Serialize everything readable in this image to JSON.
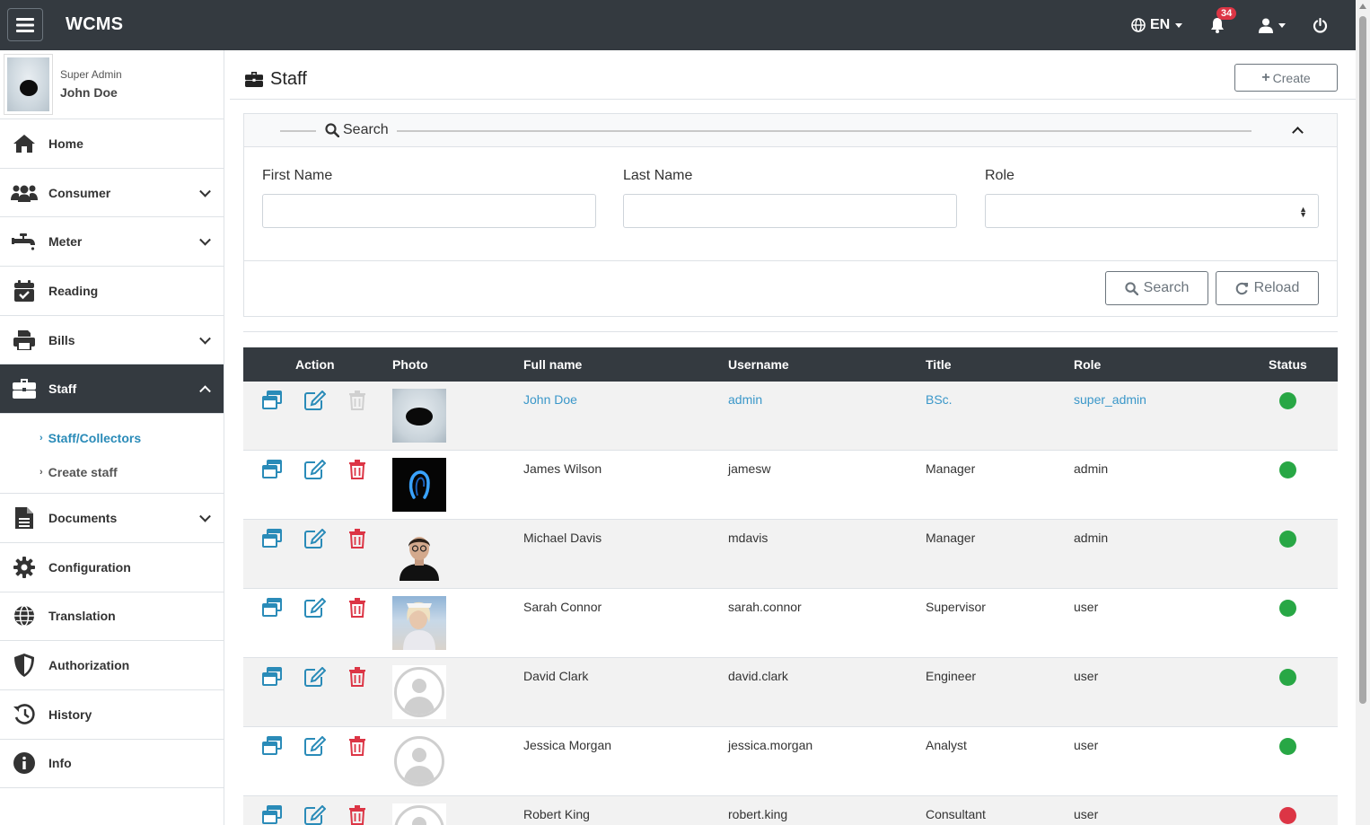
{
  "app": {
    "brand": "WCMS"
  },
  "topbar": {
    "language": "EN",
    "notification_count": "34"
  },
  "user": {
    "role": "Super Admin",
    "name": "John Doe"
  },
  "sidebar": {
    "items": [
      {
        "label": "Home",
        "icon": "home-icon"
      },
      {
        "label": "Consumer",
        "icon": "users-icon"
      },
      {
        "label": "Meter",
        "icon": "faucet-icon"
      },
      {
        "label": "Reading",
        "icon": "calendar-check-icon"
      },
      {
        "label": "Bills",
        "icon": "printer-icon"
      },
      {
        "label": "Staff",
        "icon": "briefcase-icon"
      },
      {
        "label": "Documents",
        "icon": "document-icon"
      },
      {
        "label": "Configuration",
        "icon": "gear-icon"
      },
      {
        "label": "Translation",
        "icon": "globe-icon"
      },
      {
        "label": "Authorization",
        "icon": "shield-icon"
      },
      {
        "label": "History",
        "icon": "history-icon"
      },
      {
        "label": "Info",
        "icon": "info-icon"
      }
    ],
    "staff_submenu": [
      "Staff/Collectors",
      "Create staff"
    ]
  },
  "page": {
    "title": "Staff",
    "create_label": "Create"
  },
  "search": {
    "title": "Search",
    "first_name_label": "First Name",
    "last_name_label": "Last Name",
    "role_label": "Role",
    "first_name_value": "",
    "last_name_value": "",
    "role_value": "",
    "search_button": "Search",
    "reload_button": "Reload"
  },
  "table": {
    "headers": [
      "Action",
      "Photo",
      "Full name",
      "Username",
      "Title",
      "Role",
      "Status"
    ],
    "rows": [
      {
        "full_name": "John Doe",
        "username": "admin",
        "title": "BSc.",
        "role": "super_admin",
        "status": "active",
        "photo": "dark-oval"
      },
      {
        "full_name": "James Wilson",
        "username": "jamesw",
        "title": "Manager",
        "role": "admin",
        "status": "active",
        "photo": "blue-neon"
      },
      {
        "full_name": "Michael Davis",
        "username": "mdavis",
        "title": "Manager",
        "role": "admin",
        "status": "active",
        "photo": "man-portrait"
      },
      {
        "full_name": "Sarah Connor",
        "username": "sarah.connor",
        "title": "Supervisor",
        "role": "user",
        "status": "active",
        "photo": "woman-portrait"
      },
      {
        "full_name": "David Clark",
        "username": "david.clark",
        "title": "Engineer",
        "role": "user",
        "status": "active",
        "photo": "placeholder"
      },
      {
        "full_name": "Jessica Morgan",
        "username": "jessica.morgan",
        "title": "Analyst",
        "role": "user",
        "status": "active",
        "photo": "placeholder"
      },
      {
        "full_name": "Robert King",
        "username": "robert.king",
        "title": "Consultant",
        "role": "user",
        "status": "inactive",
        "photo": "placeholder"
      }
    ]
  },
  "colors": {
    "navbar": "#343a40",
    "link": "#3a97c9",
    "status_active": "#28a745",
    "status_inactive": "#dc3545",
    "delete": "#dc3545"
  }
}
